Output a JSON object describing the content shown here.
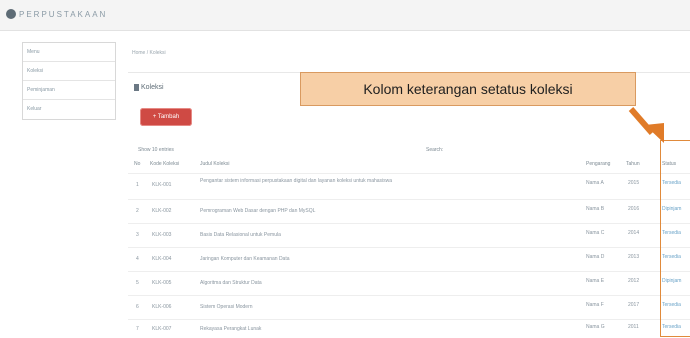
{
  "topbar": {
    "brand_text": "PERPUSTAKAAN"
  },
  "sidebar": {
    "items": [
      {
        "label": "Menu"
      },
      {
        "label": "Koleksi"
      },
      {
        "label": "Peminjaman"
      },
      {
        "label": "Keluar"
      }
    ]
  },
  "breadcrumb": "Home / Koleksi",
  "page_title": "Koleksi",
  "add_button_label": "+ Tambah",
  "table_toolbar": {
    "left": "Show 10 entries",
    "right": "Search:"
  },
  "columns": [
    "No",
    "Kode Koleksi",
    "Judul Koleksi",
    "Pengarang",
    "Tahun",
    "Status"
  ],
  "rows": [
    {
      "no": "1",
      "code": "KLK-001",
      "title": "Pengantar sistem informasi perpustakaan digital dan layanan koleksi untuk mahasiswa",
      "author": "Nama A",
      "year": "2015",
      "status": "Tersedia"
    },
    {
      "no": "2",
      "code": "KLK-002",
      "title": "Pemrograman Web Dasar dengan PHP dan MySQL",
      "author": "Nama B",
      "year": "2016",
      "status": "Dipinjam"
    },
    {
      "no": "3",
      "code": "KLK-003",
      "title": "Basis Data Relasional untuk Pemula",
      "author": "Nama C",
      "year": "2014",
      "status": "Tersedia"
    },
    {
      "no": "4",
      "code": "KLK-004",
      "title": "Jaringan Komputer dan Keamanan Data",
      "author": "Nama D",
      "year": "2013",
      "status": "Tersedia"
    },
    {
      "no": "5",
      "code": "KLK-005",
      "title": "Algoritma dan Struktur Data",
      "author": "Nama E",
      "year": "2012",
      "status": "Dipinjam"
    },
    {
      "no": "6",
      "code": "KLK-006",
      "title": "Sistem Operasi Modern",
      "author": "Nama F",
      "year": "2017",
      "status": "Tersedia"
    },
    {
      "no": "7",
      "code": "KLK-007",
      "title": "Rekayasa Perangkat Lunak",
      "author": "Nama G",
      "year": "2011",
      "status": "Tersedia"
    }
  ],
  "callout_text": "Kolom keterangan setatus koleksi",
  "colors": {
    "accent": "#cf4a44",
    "callout_fill": "#f7cfa6",
    "callout_border": "#d99a60",
    "arrow": "#e07b28"
  }
}
